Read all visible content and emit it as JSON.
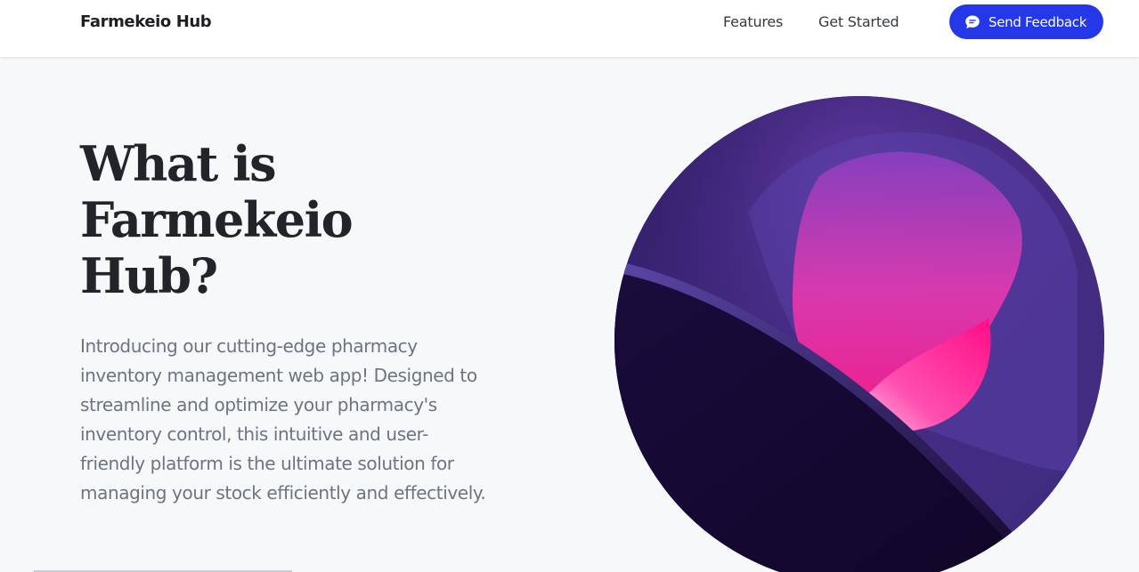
{
  "nav": {
    "brand": "Farmekeio Hub",
    "links": [
      "Features",
      "Get Started"
    ],
    "feedback_button": "Send Feedback",
    "feedback_icon": "chat-bubble-icon",
    "accent_color": "#2438e8"
  },
  "hero": {
    "title": "What is Farmekeio Hub?",
    "description": "Introducing our cutting-edge pharmacy inventory management web app! Designed to streamline and optimize your pharmacy's inventory control, this intuitive and user-friendly platform is the ultimate solution for managing your stock efficiently and effectively.",
    "image": "abstract-gradient-artwork"
  }
}
